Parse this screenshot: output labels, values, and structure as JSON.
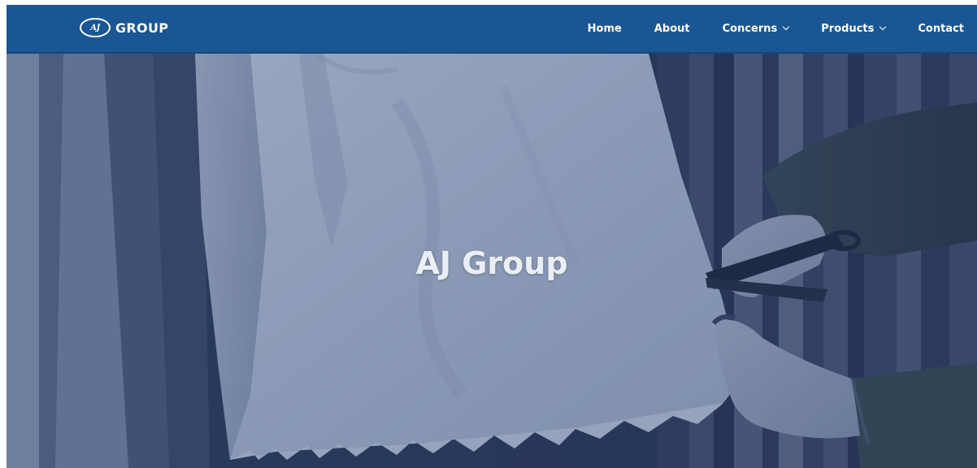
{
  "header": {
    "logo": {
      "badge": "AJ",
      "text": "GROUP",
      "icon": "aj-oval-badge-icon"
    },
    "nav": [
      {
        "label": "Home",
        "has_dropdown": false
      },
      {
        "label": "About",
        "has_dropdown": false
      },
      {
        "label": "Concerns",
        "has_dropdown": true
      },
      {
        "label": "Products",
        "has_dropdown": true
      },
      {
        "label": "Contact",
        "has_dropdown": false
      }
    ]
  },
  "hero": {
    "title": "AJ Group",
    "image_icon": "fabric-cutting-photo"
  },
  "colors": {
    "navbar": "#1a5694",
    "hero_overlay": "#1f3a6b",
    "title_text": "#ebeef3"
  }
}
